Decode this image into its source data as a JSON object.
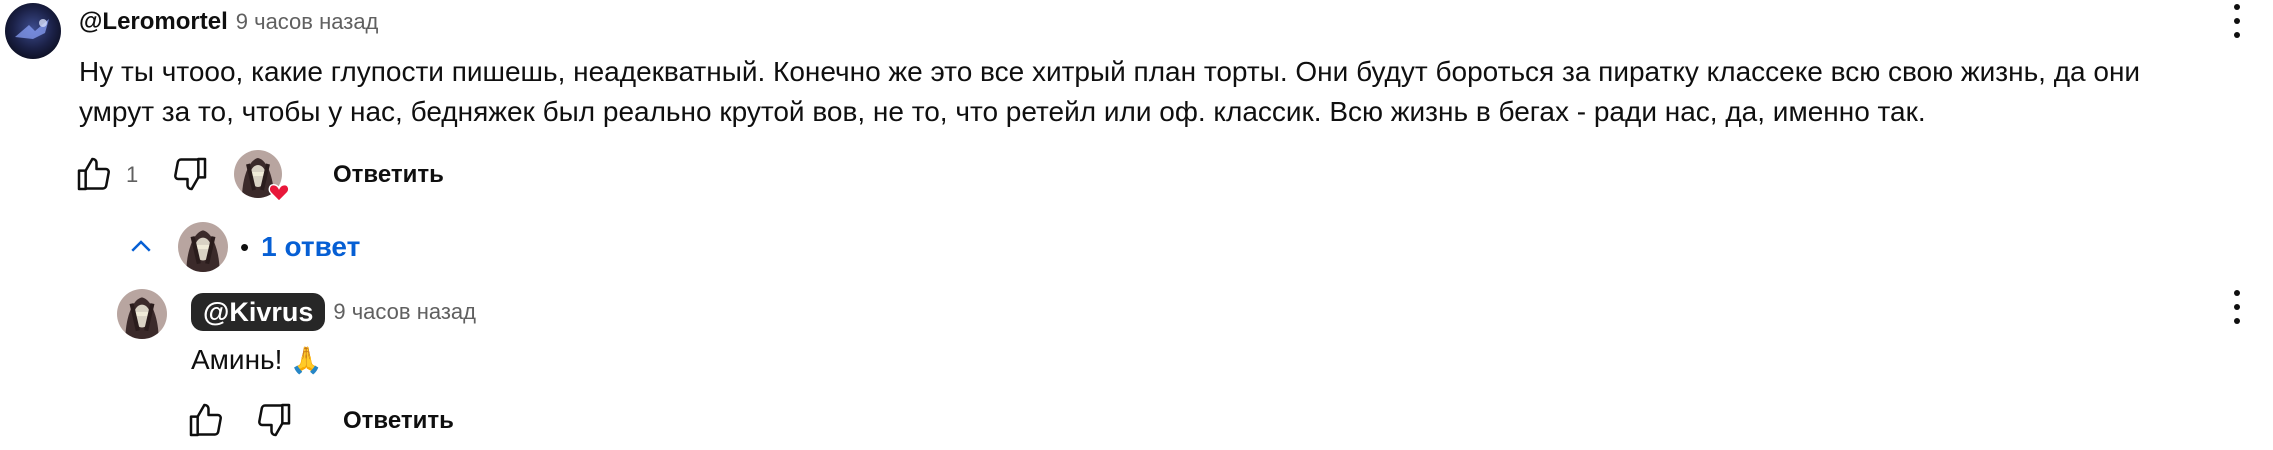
{
  "comment": {
    "author": "@Leromortel",
    "time": "9 часов назад",
    "text_line1": "Ну ты чтооо, какие глупости пишешь, неадекватный. Конечно же это все хитрый план торты. Они будут бороться за пиратку классеке всю свою жизнь, да они",
    "text_line2": "умрут за то, чтобы у нас, бедняжек был реально крутой вов, не то, что ретейл или оф. классик. Всю жизнь в бегах - ради нас, да, именно так.",
    "like_count": "1",
    "reply_label": "Ответить",
    "icons": {
      "like": "thumbs-up-icon",
      "dislike": "thumbs-down-icon",
      "menu": "more-vertical-icon",
      "heart": "creator-heart-icon"
    }
  },
  "replies": {
    "bullet": "•",
    "count_label": "1 ответ",
    "toggle_icon": "chevron-up-icon"
  },
  "reply": {
    "author": "@Kivrus",
    "time": "9 часов назад",
    "text": "Аминь!",
    "emoji": "🙏",
    "reply_label": "Ответить"
  },
  "colors": {
    "link_blue": "#065fd4",
    "chip_bg": "#272727",
    "muted": "#606060",
    "heart_red": "#e8173a"
  }
}
